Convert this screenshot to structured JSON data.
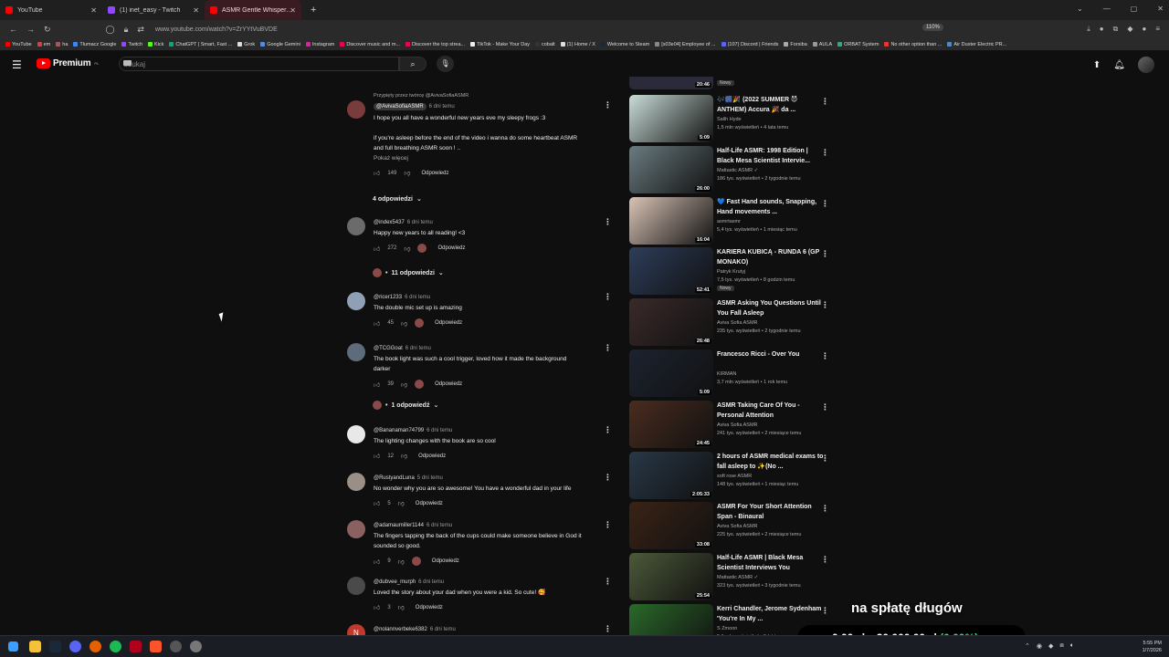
{
  "browser": {
    "tabs": [
      {
        "label": "YouTube",
        "color": "#ff0000"
      },
      {
        "label": "(1) inet_easy - Twitch",
        "color": "#9146ff"
      },
      {
        "label": "ASMR Gentle Whispers And Sleep",
        "color": "#ff0000",
        "active": true
      }
    ],
    "new_tab": "+",
    "url": "www.youtube.com/watch?v=ZrYYtVuBVDE",
    "zoom": "110%",
    "bookmarks": [
      "YouTube",
      "em",
      "ha",
      "Tłumacz Google",
      "Twitch",
      "Kick",
      "ChatGPT | Smart, Fast ...",
      "Grok",
      "Google Gemini",
      "Instagram",
      "Discover music and m...",
      "Discover the top strea...",
      "TikTok - Make Your Day",
      "cobalt",
      "(1) Home / X",
      "Welcome to Steam",
      "[s03e04] Employee of ...",
      "(107) Discord | Friends",
      "Forsiba",
      "AULA",
      "ORBAT System",
      "No other option than ...",
      "Air Duster Electric PR..."
    ]
  },
  "header": {
    "brand": "Premium",
    "brand_sup": "PL",
    "search_placeholder": "Szukaj"
  },
  "comments": [
    {
      "pinned": "Przypięty przez twórcę @AvivaSofiaASMR",
      "handle": "@AvivaSofiaASMR",
      "ago": "6 dni temu",
      "lines": [
        "I hope you all have a wonderful new years eve my sleepy frogs :3",
        "",
        "if you're asleep before the end of the video i wanna do some heartbeat ASMR",
        "and full breathing ASMR soon ! .."
      ],
      "more": "Pokaż więcej",
      "likes": "149",
      "reply": "Odpowiedz",
      "replies": "4 odpowiedzi",
      "avatar": "#7a3b3b"
    },
    {
      "handle": "@index5437",
      "ago": "6 dni temu",
      "lines": [
        "Happy new years to all reading! <3"
      ],
      "likes": "272",
      "reply": "Odpowiedz",
      "replies": "11 odpowiedzi",
      "avatar": "#6b6b6b"
    },
    {
      "handle": "@ricer1233",
      "ago": "6 dni temu",
      "lines": [
        "The double mic set up is amazing"
      ],
      "likes": "45",
      "reply": "Odpowiedz",
      "avatar": "#8fa0b5"
    },
    {
      "handle": "@TCGGoat",
      "ago": "6 dni temu",
      "lines": [
        "The book light was such a cool trigger, loved how it made the background",
        "darker"
      ],
      "likes": "39",
      "reply": "Odpowiedz",
      "replies": "1 odpowiedź",
      "avatar": "#5e6b7a"
    },
    {
      "handle": "@Bananaman74799",
      "ago": "6 dni temu",
      "lines": [
        "The lighting changes with the book are so cool"
      ],
      "likes": "12",
      "reply": "Odpowiedz",
      "avatar": "#e8e8e8"
    },
    {
      "handle": "@RustyandLuna",
      "ago": "5 dni temu",
      "lines": [
        "No wonder why you are so awesome! You have a wonderful dad in your life"
      ],
      "likes": "5",
      "reply": "Odpowiedz",
      "avatar": "#9a8f86"
    },
    {
      "handle": "@adamaumiller1144",
      "ago": "6 dni temu",
      "lines": [
        "The fingers tapping the back of the cups could make someone believe in God it",
        "sounded so good."
      ],
      "likes": "9",
      "reply": "Odpowiedz",
      "avatar": "#8a6060"
    },
    {
      "handle": "@dubvee_murph",
      "ago": "6 dni temu",
      "lines": [
        "Loved the story about your dad when you were a kid. So cute! 🥰"
      ],
      "likes": "3",
      "reply": "Odpowiedz",
      "avatar": "#4a4a4a"
    },
    {
      "handle": "@nolannverbeke6382",
      "ago": "6 dni temu",
      "lines": [],
      "avatar": "#c0392b",
      "initial": "N"
    }
  ],
  "sidebar": {
    "top_duration": "20:46",
    "top_badge": "Nowy",
    "videos": [
      {
        "title": "🎶🎆🎉 (2022 SUMMER 😈 ANTHEM) Accura 🎉 da ...",
        "channel": "Salih Hyde",
        "meta": "1,5 mln wyświetleń • 4 lata temu",
        "dur": "5:09",
        "thumb": "#c9ddd8"
      },
      {
        "title": "Half-Life ASMR: 1998 Edition | Black Mesa Scientist Intervie...",
        "channel": "Mattastic ASMR ✓",
        "meta": "186 tys. wyświetleń • 2 tygodnie temu",
        "dur": "26:00",
        "thumb": "#6a7b80"
      },
      {
        "title": "💙 Fast Hand sounds, Snapping, Hand movements ...",
        "channel": "asmrtasmr",
        "meta": "5,4 tys. wyświetleń • 1 miesiąc temu",
        "dur": "16:04",
        "thumb": "#d9c4b6"
      },
      {
        "title": "KARIERA KUBICĄ - RUNDA 6 (GP MONAKO)",
        "channel": "Patryk Krutyj",
        "meta": "7,5 tys. wyświetleń • 8 godzin temu",
        "dur": "52:41",
        "badge": "Nowy",
        "thumb": "#2d3d5a"
      },
      {
        "title": "ASMR Asking You Questions Until You Fall Asleep",
        "channel": "Aviva Sofia ASMR",
        "meta": "235 tys. wyświetleń • 2 tygodnie temu",
        "dur": "26:48",
        "thumb": "#3a2a2a"
      },
      {
        "title": "Francesco Ricci - Over You",
        "channel": "KIRMAN",
        "meta": "3,7 mln wyświetleń • 1 rok temu",
        "dur": "5:09",
        "thumb": "#1c2330"
      },
      {
        "title": "ASMR Taking Care Of You - Personal Attention",
        "channel": "Aviva Sofia ASMR",
        "meta": "241 tys. wyświetleń • 2 miesiące temu",
        "dur": "24:45",
        "thumb": "#4a2c1f"
      },
      {
        "title": "2 hours of ASMR medical exams to fall asleep to ✨(No ...",
        "channel": "soft rose ASMR",
        "meta": "148 tys. wyświetleń • 1 miesiąc temu",
        "dur": "2:05:33",
        "thumb": "#283848"
      },
      {
        "title": "ASMR For Your Short Attention Span - Binaural",
        "channel": "Aviva Sofia ASMR",
        "meta": "225 tys. wyświetleń • 2 miesiące temu",
        "dur": "33:08",
        "thumb": "#3b2316"
      },
      {
        "title": "Half-Life ASMR | Black Mesa Scientist Interviews You",
        "channel": "Mattastic ASMR ✓",
        "meta": "323 tys. wyświetleń • 3 tygodnie temu",
        "dur": "25:54",
        "thumb": "#4c5a3a"
      },
      {
        "title": "Kerri Chandler, Jerome Sydenham 'You're In My ...",
        "channel": "S Zmoon",
        "meta": "5,1 mln wyświetleń • 5 lat temu",
        "dur": "",
        "thumb": "#2a6a2a"
      }
    ]
  },
  "overlay": {
    "title": "na spłatę długów",
    "amount_current": "0,00 zł",
    "amount_sep": "z",
    "amount_target": "30 000,00 zł",
    "percent": "(0.00%)",
    "percent_color": "#31e36b"
  },
  "taskbar": {
    "time": "5:55 PM",
    "date": "1/7/2026"
  }
}
